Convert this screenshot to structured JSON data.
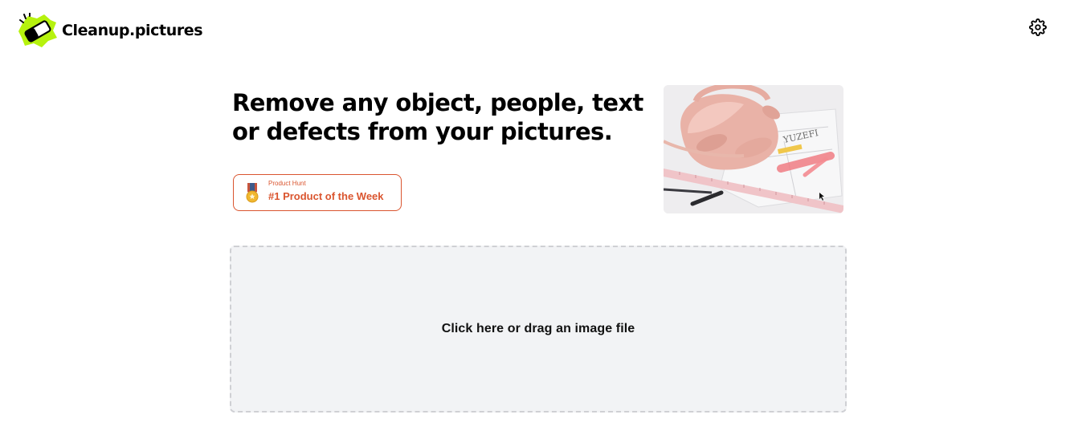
{
  "header": {
    "app_name": "Cleanup.pictures",
    "logo_icon": "eraser-splash-logo",
    "settings_icon": "gear-icon"
  },
  "hero": {
    "headline": "Remove any object, people, text or defects from your pictures."
  },
  "product_hunt": {
    "small_label": "Product Hunt",
    "title": "#1 Product of the Week",
    "icon": "medal-icon",
    "color": "#da552f"
  },
  "dropzone": {
    "label": "Click here or drag an image file"
  },
  "colors": {
    "brand_lime": "#b6f20e",
    "product_hunt_orange": "#da552f",
    "dropzone_bg": "#f2f3f5",
    "dropzone_border": "#cfd0d4"
  }
}
